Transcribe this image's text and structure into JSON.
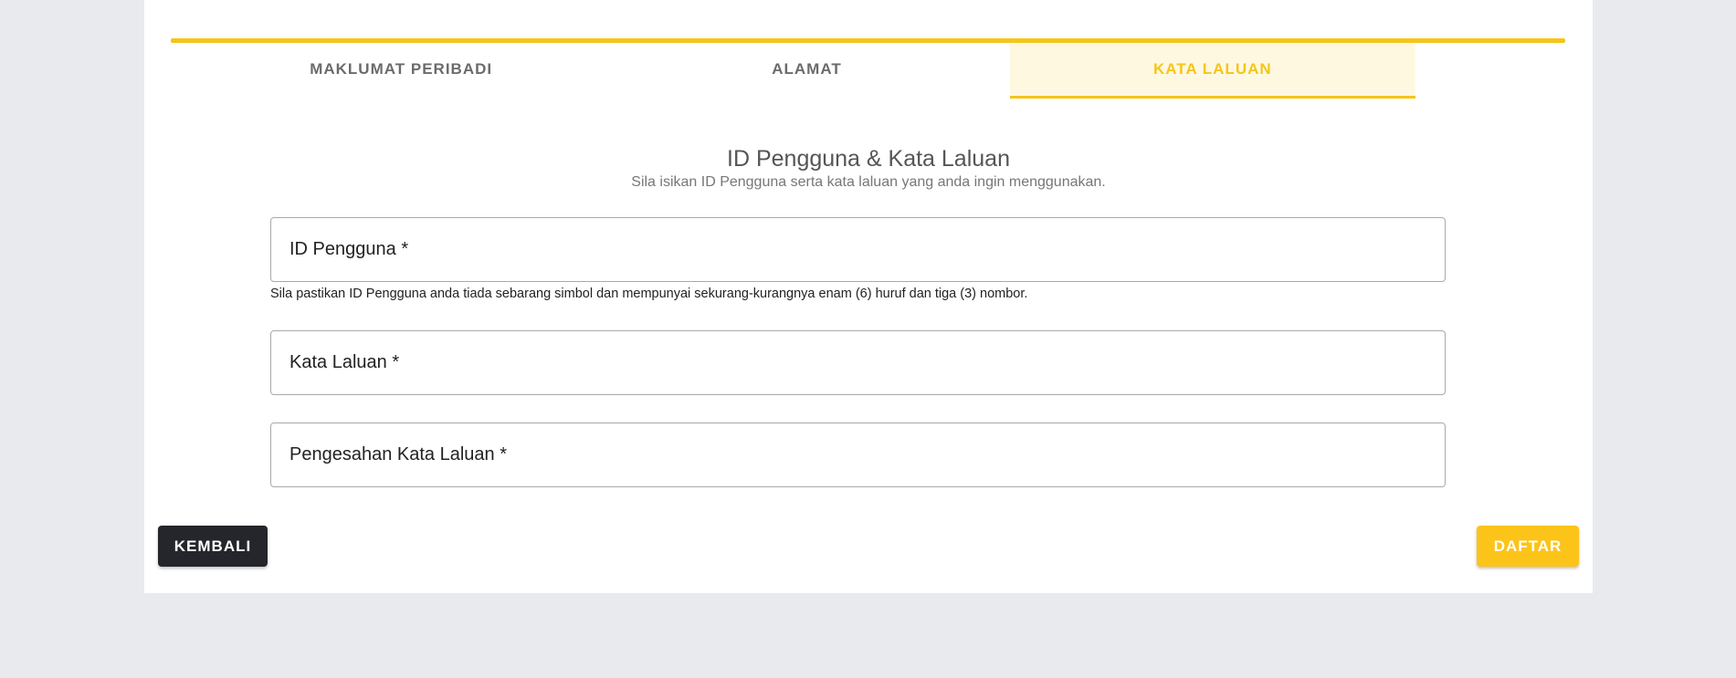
{
  "tabs": [
    {
      "label": "MAKLUMAT PERIBADI",
      "active": false
    },
    {
      "label": "ALAMAT",
      "active": false
    },
    {
      "label": "KATA LALUAN",
      "active": true
    }
  ],
  "section": {
    "title": "ID Pengguna & Kata Laluan",
    "subtitle": "Sila isikan ID Pengguna serta kata laluan yang anda ingin menggunakan."
  },
  "form": {
    "userid_label": "ID Pengguna *",
    "userid_hint": "Sila pastikan ID Pengguna anda tiada sebarang simbol dan mempunyai sekurang-kurangnya enam (6) huruf dan tiga (3) nombor.",
    "password_label": "Kata Laluan *",
    "confirm_label": "Pengesahan Kata Laluan *"
  },
  "actions": {
    "back_label": "KEMBALI",
    "submit_label": "DAFTAR"
  },
  "colors": {
    "accent": "#f5c518",
    "accent_bg": "#fff8e1",
    "back_button": "#24262b",
    "submit_button": "#fcc419",
    "page_bg": "#e9eaee"
  }
}
